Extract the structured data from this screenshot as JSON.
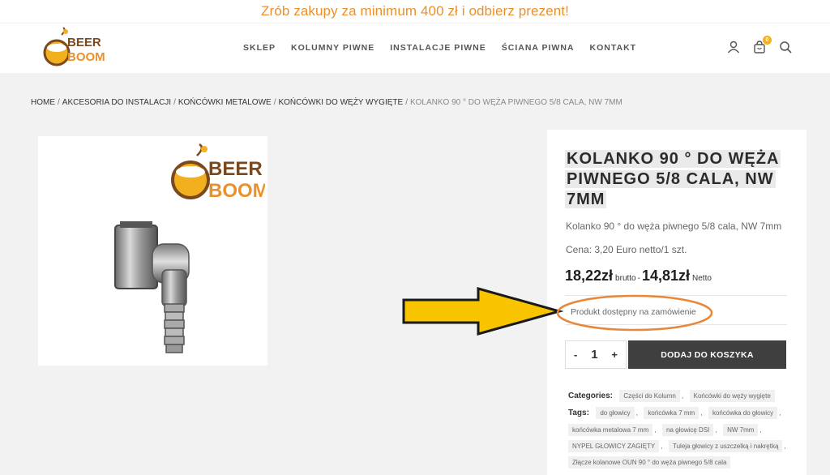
{
  "promo": {
    "text": "Zrób zakupy za minimum 400 zł i odbierz prezent!"
  },
  "header": {
    "logo_text_top": "BEER",
    "logo_text_bottom": "BOOM",
    "nav": [
      "SKLEP",
      "KOLUMNY PIWNE",
      "INSTALACJE PIWNE",
      "ŚCIANA PIWNA",
      "KONTAKT"
    ],
    "cart_count": "0",
    "icons": [
      "user-icon",
      "cart-icon",
      "search-icon"
    ]
  },
  "breadcrumb": {
    "items": [
      "HOME",
      "AKCESORIA DO INSTALACJI",
      "KOŃCÓWKI METALOWE",
      "KOŃCÓWKI DO WĘŻY WYGIĘTE"
    ],
    "current": "KOLANKO 90 ° DO WĘŻA PIWNEGO 5/8 CALA, NW 7MM"
  },
  "product": {
    "title": "KOLANKO 90 ° DO WĘŻA PIWNEGO 5/8 CALA, NW 7MM",
    "short_description": "Kolanko 90 ° do węża piwnego 5/8 cala, NW 7mm",
    "price_note": "Cena: 3,20 Euro netto/1 szt.",
    "price_gross": "18,22zł",
    "gross_label": "brutto",
    "price_separator": "-",
    "price_net": "14,81zł",
    "net_label": "Netto",
    "availability": "Produkt dostępny na zamówienie",
    "quantity": "1",
    "qty_minus": "-",
    "qty_plus": "+",
    "add_to_cart_label": "DODAJ DO KOSZYKA",
    "image_logo_top": "BEER",
    "image_logo_bottom": "BOOM"
  },
  "meta": {
    "categories_label": "Categories:",
    "categories": [
      "Części do Kolumn",
      "Końcówki do węży wygięte"
    ],
    "tags_label": "Tags:",
    "tags": [
      "do głowicy",
      "końcówka 7 mm",
      "końcówka do głowicy",
      "końcówka metalowa 7 mm",
      "na głowicę DSI",
      "NW 7mm",
      "NYPEL GŁOWICY ZAGIĘTY",
      "Tuleja głowicy z uszczelką i nakrętką",
      "Złącze kolanowe OUN 90 ° do węża piwnego 5/8 cala"
    ]
  },
  "colors": {
    "promo": "#e8912d",
    "accent_gold": "#f2b01e",
    "arrow_fill": "#f8c400",
    "annotation_circle": "#e8873a",
    "button_bg": "#3f3f3f"
  }
}
